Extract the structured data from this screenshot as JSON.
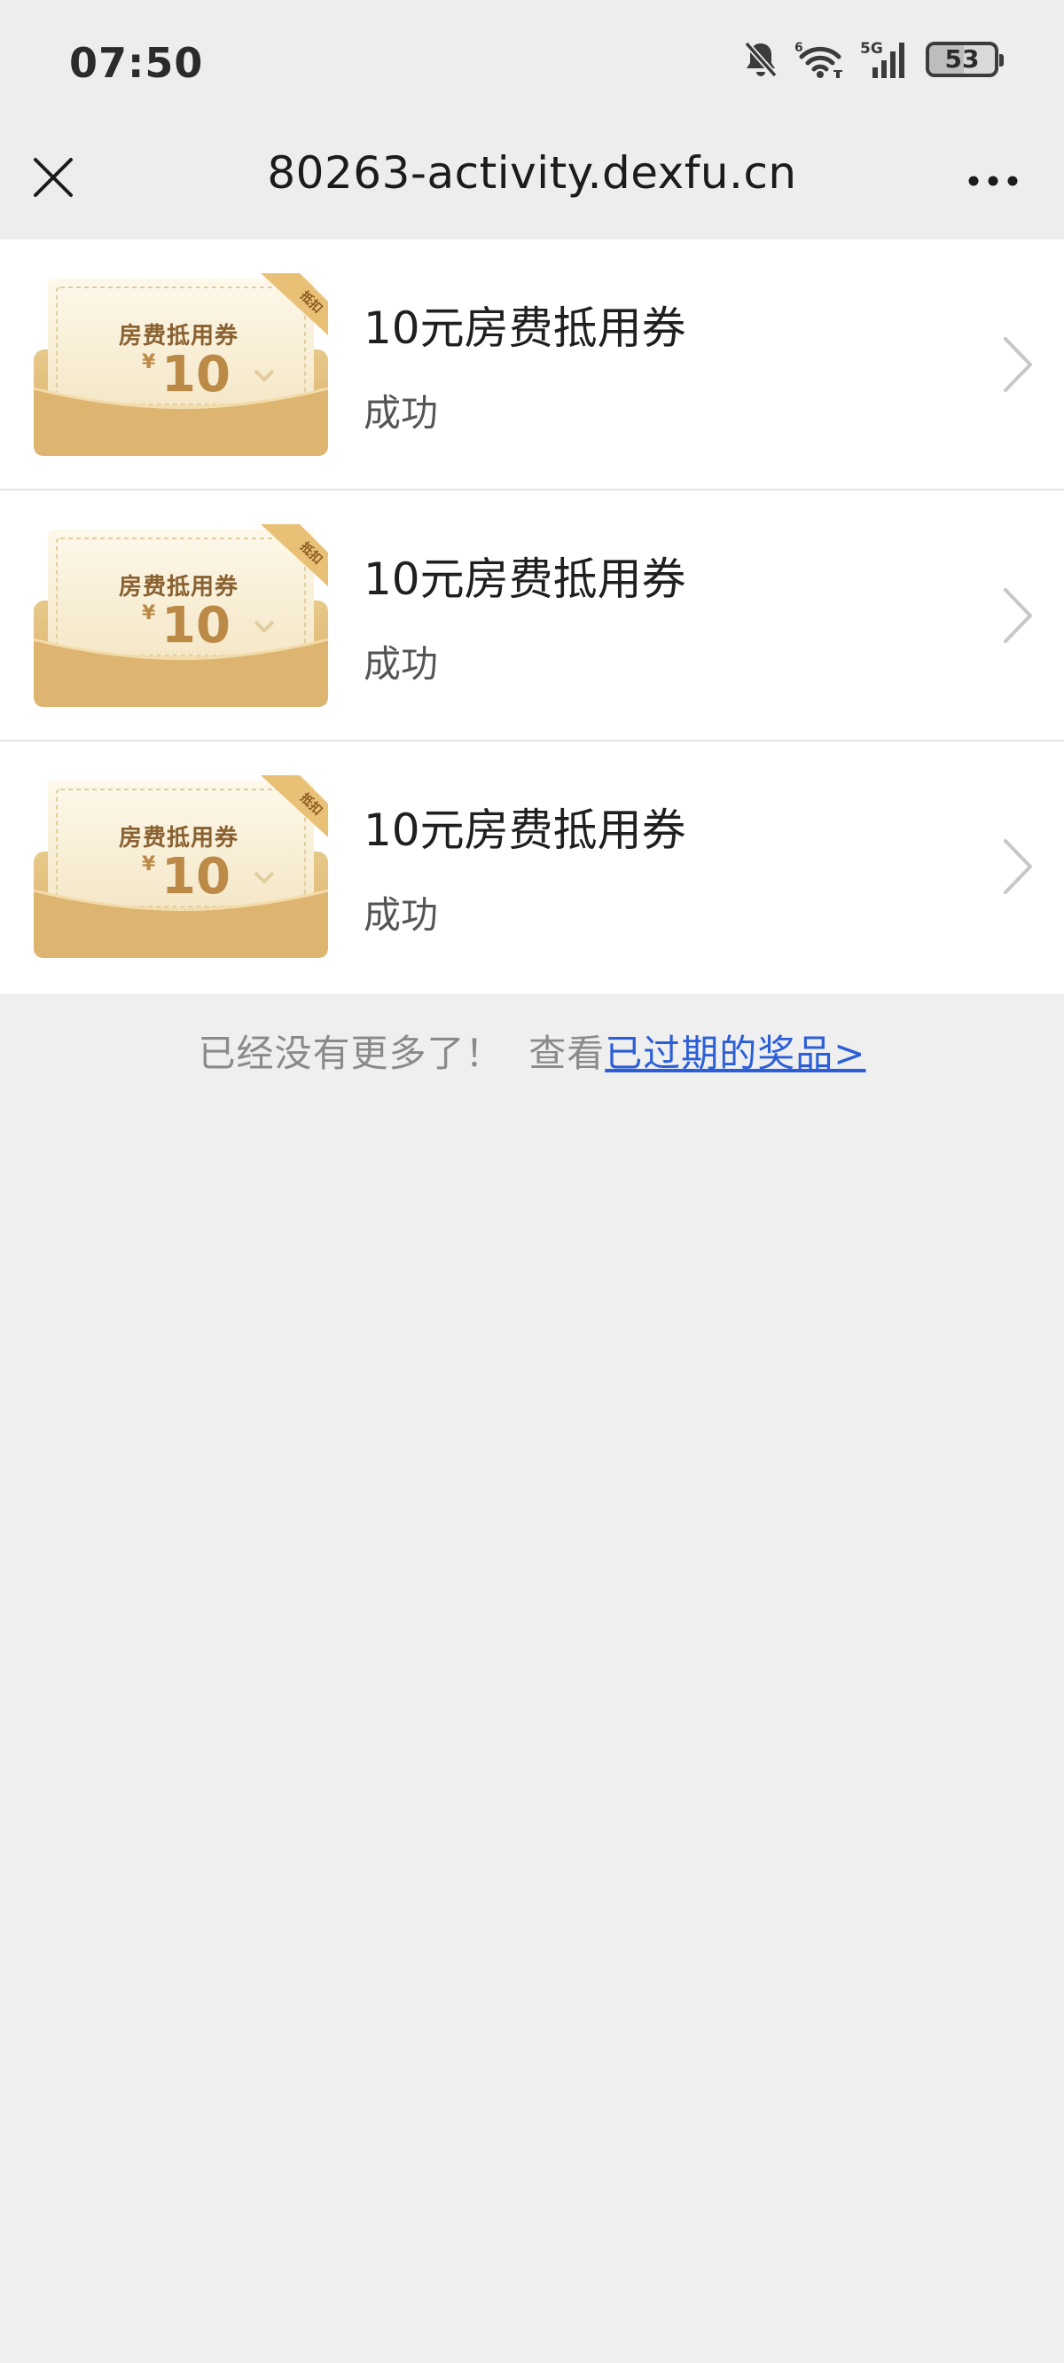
{
  "status_bar": {
    "time": "07:50",
    "battery": "53",
    "battery_level": 0.53,
    "network_label": "5G",
    "wifi_label": "6"
  },
  "nav": {
    "title": "80263-activity.dexfu.cn",
    "close_icon": "close-icon",
    "more_icon": "more-icon"
  },
  "prizes": [
    {
      "coupon_label": "房费抵用券",
      "coupon_currency": "¥",
      "coupon_amount": "10",
      "coupon_tag": "抵扣",
      "title": "10元房费抵用券",
      "status": "成功"
    },
    {
      "coupon_label": "房费抵用券",
      "coupon_currency": "¥",
      "coupon_amount": "10",
      "coupon_tag": "抵扣",
      "title": "10元房费抵用券",
      "status": "成功"
    },
    {
      "coupon_label": "房费抵用券",
      "coupon_currency": "¥",
      "coupon_amount": "10",
      "coupon_tag": "抵扣",
      "title": "10元房费抵用券",
      "status": "成功"
    }
  ],
  "footer": {
    "no_more_text": "已经没有更多了！",
    "view_text": "查看",
    "expired_link": "已过期的奖品>"
  },
  "colors": {
    "link": "#2b5fd9",
    "coupon_gold": "#bb8a47",
    "background": "#efefef"
  }
}
